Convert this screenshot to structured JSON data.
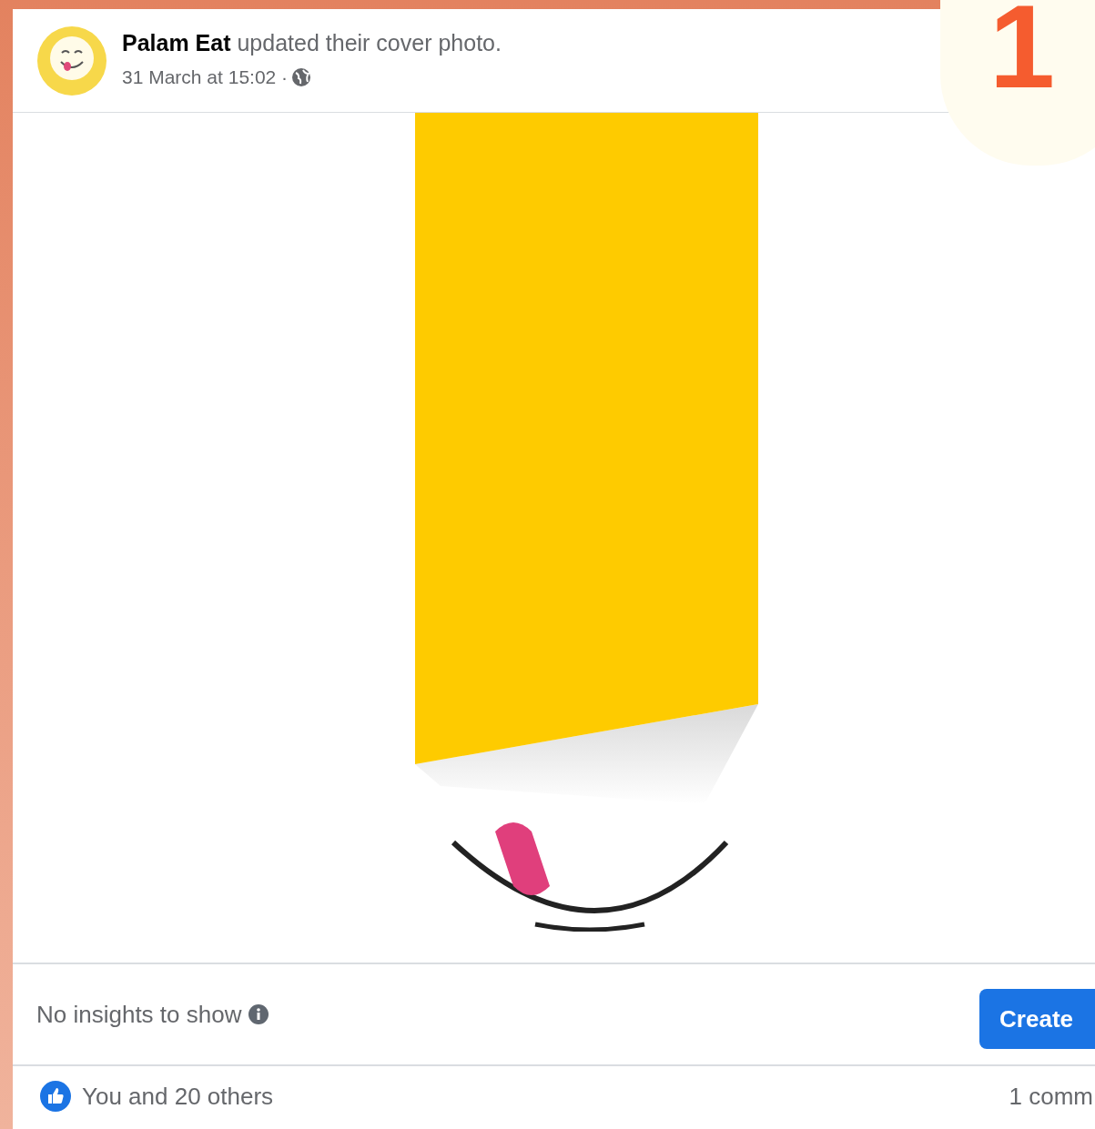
{
  "step_badge": "1",
  "post": {
    "headline": "**Palam Eat** updated their cover photo.",
    "timestamp": "31 March at 15:02 ·"
  },
  "insights": {
    "text": "No insights to show",
    "button": "Create"
  },
  "footer": {
    "reactions": "You and 20 others",
    "comments": "1 comm"
  }
}
